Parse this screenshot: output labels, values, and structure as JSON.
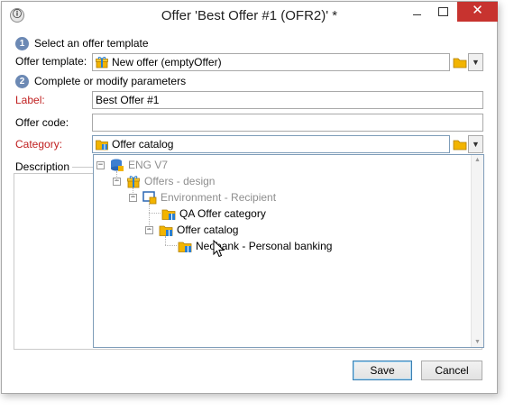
{
  "window": {
    "title": "Offer 'Best Offer #1 (OFR2)' *",
    "close_glyph": "✕"
  },
  "steps": [
    {
      "number": "1",
      "label": "Select an offer template"
    },
    {
      "number": "2",
      "label": "Complete or modify parameters"
    }
  ],
  "form": {
    "offer_template_label": "Offer template:",
    "offer_template_value": "New offer (emptyOffer)",
    "label_label": "Label:",
    "label_value": "Best Offer #1",
    "offer_code_label": "Offer code:",
    "offer_code_value": "",
    "category_label": "Category:",
    "category_value": "Offer catalog",
    "description_label": "Description"
  },
  "tree": [
    {
      "label": "ENG V7",
      "icon": "database-icon",
      "expander": "⊟"
    },
    {
      "label": "Offers - design",
      "icon": "gift-icon",
      "expander": "⊟"
    },
    {
      "label": "Environment - Recipient",
      "icon": "environment-icon",
      "expander": "⊟"
    },
    {
      "label": "QA Offer category",
      "icon": "folder-gift-icon",
      "expander": ""
    },
    {
      "label": "Offer catalog",
      "icon": "folder-gift-icon",
      "expander": "⊟"
    },
    {
      "label": "Neobank - Personal banking",
      "icon": "folder-gift-icon",
      "expander": ""
    }
  ],
  "buttons": {
    "save": "Save",
    "cancel": "Cancel"
  },
  "colors": {
    "required_label": "#c02020",
    "close_button": "#c7332f",
    "step_badge": "#6c89b4",
    "folder": "#f2b400"
  }
}
